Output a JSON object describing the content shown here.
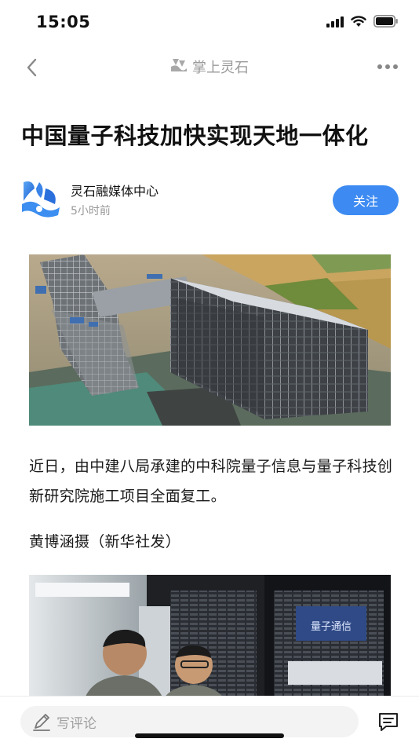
{
  "status_bar": {
    "time": "15:05",
    "icons": [
      "signal-icon",
      "wifi-icon",
      "battery-icon"
    ]
  },
  "nav": {
    "title": "掌上灵石",
    "icons": [
      "back-icon",
      "app-logo-icon",
      "more-icon"
    ]
  },
  "article": {
    "title": "中国量子科技加快实现天地一体化",
    "author": {
      "name": "灵石融媒体中心",
      "time": "5小时前",
      "follow_label": "关注"
    },
    "paragraphs": [
      "近日，由中建八局承建的中科院量子信息与量子科技创新研究院施工项目全面复工。",
      "黄博涵摄（新华社发）"
    ],
    "images": [
      "construction-site-aerial-photo",
      "server-room-engineers-photo"
    ],
    "image_labels": [
      "量子通信"
    ]
  },
  "bottom_bar": {
    "comment_placeholder": "写评论",
    "icons": [
      "pencil-icon",
      "comments-icon"
    ]
  },
  "colors": {
    "accent": "#3d8bf2",
    "muted_text": "#999999",
    "title_text": "#111111"
  }
}
